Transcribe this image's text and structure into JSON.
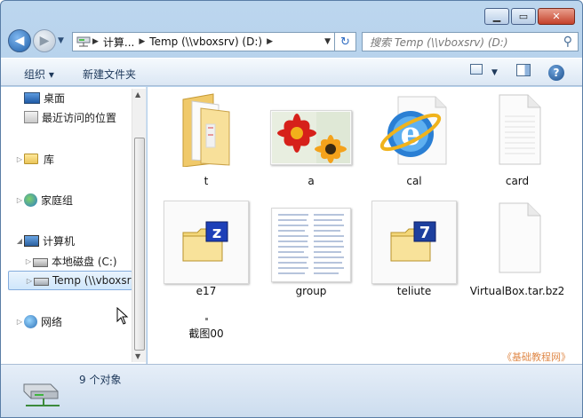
{
  "address": {
    "crumbs": [
      "计算...",
      "Temp (\\\\vboxsrv) (D:)"
    ]
  },
  "search": {
    "placeholder": "搜索 Temp (\\\\vboxsrv) (D:)"
  },
  "toolbar": {
    "organize": "组织 ▾",
    "new_folder": "新建文件夹"
  },
  "nav": {
    "items": [
      {
        "label": "桌面"
      },
      {
        "label": "最近访问的位置"
      },
      {
        "label": "库"
      },
      {
        "label": "家庭组"
      },
      {
        "label": "计算机"
      },
      {
        "label": "本地磁盘 (C:)"
      },
      {
        "label": "Temp (\\\\vboxsr"
      },
      {
        "label": "网络"
      }
    ]
  },
  "files": [
    {
      "name": "t",
      "icon": "folder-icon"
    },
    {
      "name": "a",
      "icon": "flower-image-icon"
    },
    {
      "name": "cal",
      "icon": "ie-icon"
    },
    {
      "name": "card",
      "icon": "blank-file-icon"
    },
    {
      "name": "e17",
      "icon": "z-folder-icon"
    },
    {
      "name": "group",
      "icon": "text-document-icon"
    },
    {
      "name": "teliute",
      "icon": "seven-folder-icon"
    },
    {
      "name": "VirtualBox.tar.bz2",
      "icon": "blank-file-icon"
    },
    {
      "name": "截图00",
      "icon": "small-image-icon"
    }
  ],
  "watermark": "《基础教程网》",
  "status": {
    "count": "9 个对象"
  },
  "colors": {
    "accent": "#1f5fa8",
    "watermark": "#e08a4a"
  }
}
